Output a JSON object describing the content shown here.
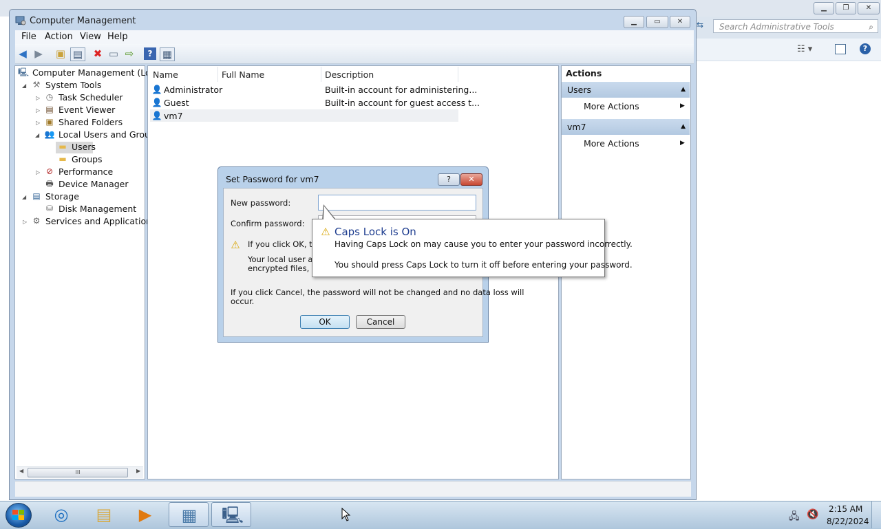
{
  "background_window": {
    "search_placeholder": "Search Administrative Tools"
  },
  "window": {
    "title": "Computer Management",
    "menu": [
      "File",
      "Action",
      "View",
      "Help"
    ]
  },
  "tree": {
    "root": "Computer Management (Local",
    "system_tools": "System Tools",
    "task_scheduler": "Task Scheduler",
    "event_viewer": "Event Viewer",
    "shared_folders": "Shared Folders",
    "local_users_groups": "Local Users and Groups",
    "users": "Users",
    "groups": "Groups",
    "performance": "Performance",
    "device_manager": "Device Manager",
    "storage": "Storage",
    "disk_management": "Disk Management",
    "services_apps": "Services and Applications",
    "hscroll_thumb": "III"
  },
  "list": {
    "columns": [
      "Name",
      "Full Name",
      "Description"
    ],
    "rows": [
      {
        "name": "Administrator",
        "full_name": "",
        "description": "Built-in account for administering..."
      },
      {
        "name": "Guest",
        "full_name": "",
        "description": "Built-in account for guest access t..."
      },
      {
        "name": "vm7",
        "full_name": "",
        "description": ""
      }
    ]
  },
  "actions": {
    "header": "Actions",
    "groups": [
      {
        "title": "Users",
        "item": "More Actions"
      },
      {
        "title": "vm7",
        "item": "More Actions"
      }
    ]
  },
  "dialog": {
    "title": "Set Password for vm7",
    "help": "?",
    "close": "✕",
    "new_password_label": "New password:",
    "confirm_password_label": "Confirm password:",
    "warning_line1": "If you click OK, the",
    "warning_line2": "Your local user acco",
    "warning_line3": "encrypted files, store",
    "cancel_note_line1": "If you click Cancel, the password will not be changed and no data loss will",
    "cancel_note_line2": "occur.",
    "ok": "OK",
    "cancel": "Cancel"
  },
  "balloon": {
    "title": "Caps Lock is On",
    "line1": "Having Caps Lock on may cause you to enter your password incorrectly.",
    "line2": "You should press Caps Lock to turn it off before entering your password."
  },
  "taskbar": {
    "time": "2:15 AM",
    "date": "8/22/2024"
  }
}
